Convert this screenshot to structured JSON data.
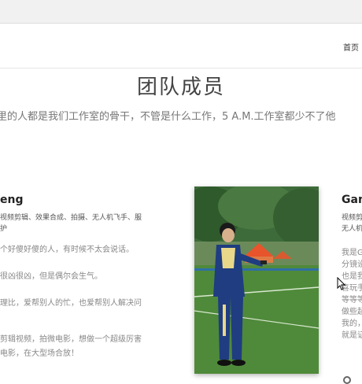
{
  "nav": {
    "home_label": "首页"
  },
  "page": {
    "title": "团队成员",
    "subtitle": "里的人都是我们工作室的骨干，不管是什么工作，5 A.M.工作室都少不了他"
  },
  "member_left": {
    "name": "eng",
    "skills": [
      "视频剪辑、效果合成、拍摄、无人机飞手、服",
      "护"
    ],
    "desc": [
      "个好傻好傻的人，有时候不太会说话。",
      "很凶很凶，但是偶尔会生气。",
      "理比，爱帮别人的忙，也爱帮别人解决问",
      "剪辑视频，拍微电影，想做一个超级厉害",
      "电影，在大型场合放！"
    ]
  },
  "member_right": {
    "name": "Gam",
    "skills": [
      "视频剪",
      "无人机"
    ],
    "desc": [
      "我是G",
      "分镜设",
      "也是我",
      "喜玩手",
      "等等等",
      "做些起",
      "我的，",
      "就是证"
    ]
  },
  "colors": {
    "accent": "#f05a28",
    "grass": "#4f8a3a",
    "jacket": "#1f3d80"
  }
}
